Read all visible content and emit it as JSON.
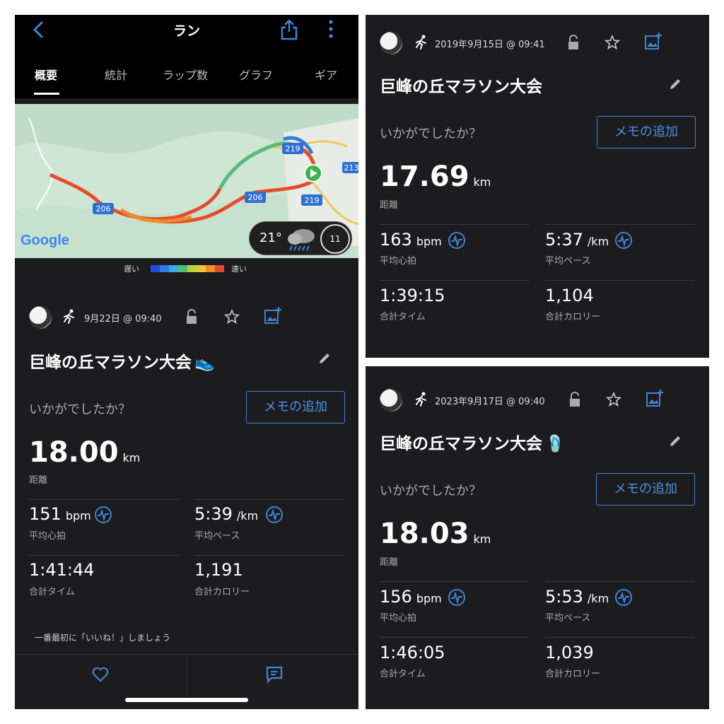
{
  "left": {
    "header": {
      "title": "ラン"
    },
    "tabs": [
      "概要",
      "統計",
      "ラップ数",
      "グラフ",
      "ギア"
    ],
    "map": {
      "route_labels": [
        "206",
        "206",
        "219",
        "219",
        "213"
      ],
      "weather_temp": "21°",
      "wind": "11",
      "google_logo": "Google"
    },
    "legend": {
      "slow": "遅い",
      "fast": "速い",
      "colors": [
        "#1f4fd8",
        "#2f7be0",
        "#41a6e6",
        "#4fc07a",
        "#b6d43c",
        "#f0c43a",
        "#f08a2a",
        "#e04a2a"
      ]
    },
    "activity": {
      "date": "9月22日 @ 09:40",
      "title": "巨峰の丘マラソン大会",
      "question": "いかがでしたか？",
      "memo_button": "メモの追加",
      "distance": "18.00",
      "distance_unit": "km",
      "distance_label": "距離",
      "hr": "151",
      "hr_unit": "bpm",
      "hr_label": "平均心拍",
      "pace": "5:39",
      "pace_unit": "/km",
      "pace_label": "平均ペース",
      "time": "1:41:44",
      "time_label": "合計タイム",
      "cal": "1,191",
      "cal_label": "合計カロリー"
    },
    "like_prompt": "一番最初に「いいね！」しましょう"
  },
  "top_right": {
    "date": "2019年9月15日 @ 09:41",
    "title": "巨峰の丘マラソン大会",
    "question": "いかがでしたか？",
    "memo_button": "メモの追加",
    "distance": "17.69",
    "distance_unit": "km",
    "distance_label": "距離",
    "hr": "163",
    "hr_unit": "bpm",
    "hr_label": "平均心拍",
    "pace": "5:37",
    "pace_unit": "/km",
    "pace_label": "平均ペース",
    "time": "1:39:15",
    "time_label": "合計タイム",
    "cal": "1,104",
    "cal_label": "合計カロリー"
  },
  "bottom_right": {
    "date": "2023年9月17日 @ 09:40",
    "title": "巨峰の丘マラソン大会",
    "question": "いかがでしたか？",
    "memo_button": "メモの追加",
    "distance": "18.03",
    "distance_unit": "km",
    "distance_label": "距離",
    "hr": "156",
    "hr_unit": "bpm",
    "hr_label": "平均心拍",
    "pace": "5:53",
    "pace_unit": "/km",
    "pace_label": "平均ペース",
    "time": "1:46:05",
    "time_label": "合計タイム",
    "cal": "1,039",
    "cal_label": "合計カロリー"
  },
  "colors": {
    "accent": "#3f82d6",
    "panel_bg": "#1c1c1e",
    "topbar_bg": "#000000"
  }
}
